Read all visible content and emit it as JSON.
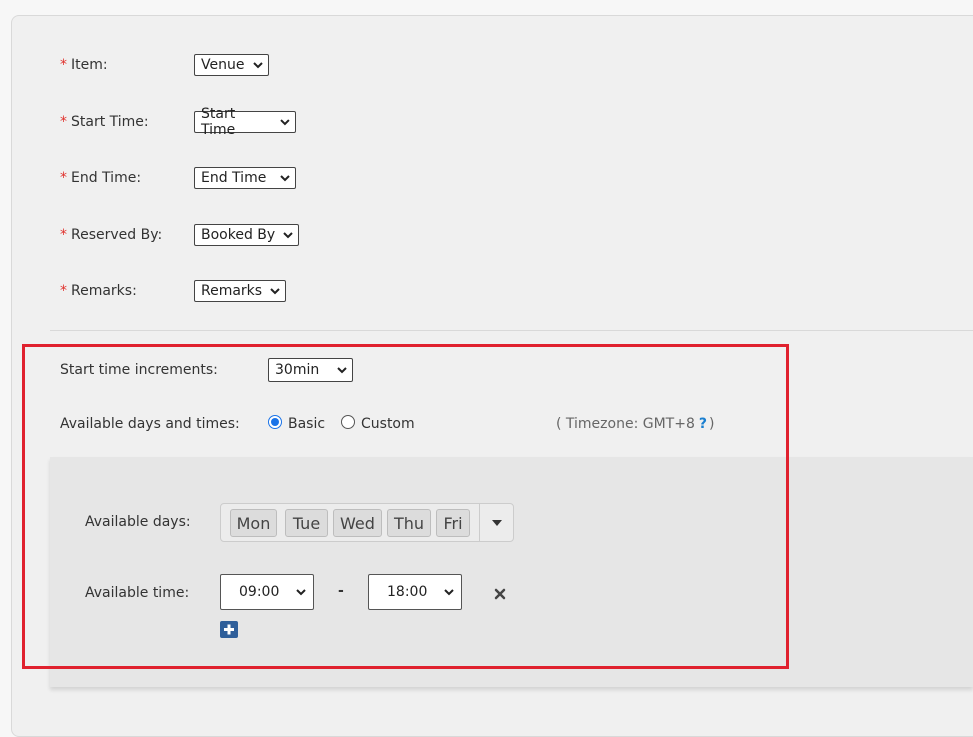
{
  "form": {
    "fields": [
      {
        "label": "Item:",
        "value": "Venue"
      },
      {
        "label": "Start Time:",
        "value": "Start Time"
      },
      {
        "label": "End Time:",
        "value": "End Time"
      },
      {
        "label": "Reserved By:",
        "value": "Booked By"
      },
      {
        "label": "Remarks:",
        "value": "Remarks"
      }
    ],
    "required_mark": "*"
  },
  "settings": {
    "increments_label": "Start time increments:",
    "increments_value": "30min",
    "available_label": "Available days and times:",
    "mode_basic": "Basic",
    "mode_custom": "Custom",
    "selected_mode": "Basic",
    "timezone_prefix": "( Timezone: GMT+8",
    "timezone_help": "?",
    "timezone_suffix": ")"
  },
  "basic": {
    "days_label": "Available days:",
    "days": [
      "Mon",
      "Tue",
      "Wed",
      "Thu",
      "Fri"
    ],
    "time_label": "Available time:",
    "start": "09:00",
    "separator": "-",
    "end": "18:00"
  },
  "colors": {
    "required": "#e0312c",
    "highlight": "#e0212e",
    "radio_selected": "#1a73e8",
    "add_button": "#2f5f9a"
  },
  "icons": {
    "select_arrow": "chevron-down-icon",
    "days_dropdown": "caret-down-icon",
    "remove_time": "close-icon",
    "add_time": "plus-icon",
    "timezone_help": "help-icon"
  }
}
